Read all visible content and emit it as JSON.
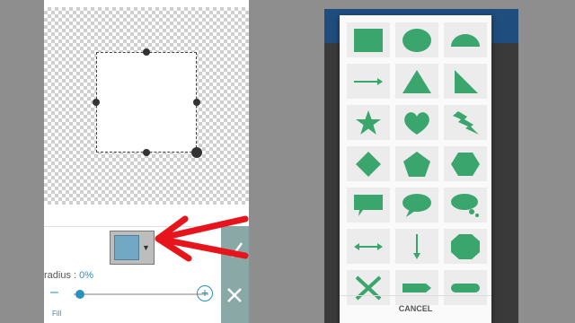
{
  "left_editor": {
    "radius_label": "radius : ",
    "radius_value": "0%",
    "minus_symbol": "–",
    "plus_symbol": "+",
    "fill_label": "Fill",
    "shape_swatch_color": "#72a8c4",
    "action_bar_color": "#8aa9a6"
  },
  "annotation": {
    "arrow_color": "#e8141b"
  },
  "shape_dialog": {
    "shape_color": "#3aa66e",
    "shapes": [
      "rectangle-shape-icon",
      "ellipse-shape-icon",
      "half-circle-shape-icon",
      "arrow-shape-icon",
      "triangle-shape-icon",
      "right-triangle-shape-icon",
      "star-shape-icon",
      "heart-shape-icon",
      "lightning-shape-icon",
      "diamond-shape-icon",
      "pentagon-shape-icon",
      "hexagon-shape-icon",
      "rect-callout-shape-icon",
      "oval-callout-shape-icon",
      "thought-cloud-shape-icon",
      "double-arrow-shape-icon",
      "down-arrow-shape-icon",
      "octagon-shape-icon",
      "cross-shape-icon",
      "arrow-block-shape-icon",
      "rounded-block-shape-icon"
    ],
    "cancel_label": "CANCEL"
  }
}
